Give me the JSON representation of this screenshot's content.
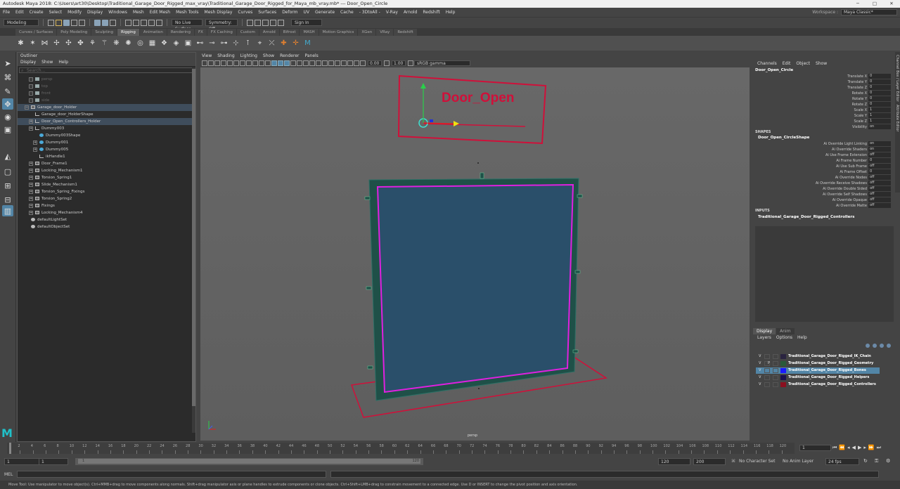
{
  "title": "Autodesk Maya 2018: C:\\Users\\art30\\Desktop\\Traditional_Garage_Door_Rigged_max_vray\\Traditional_Garage_Door_Rigged_for_Maya_mb_vray.mb*   ---   Door_Open_Circle",
  "menus": [
    "File",
    "Edit",
    "Create",
    "Select",
    "Modify",
    "Display",
    "Windows",
    "Mesh",
    "Edit Mesh",
    "Mesh Tools",
    "Mesh Display",
    "Curves",
    "Surfaces",
    "Deform",
    "UV",
    "Generate",
    "Cache",
    "- 3DtoAll -",
    "V-Ray",
    "Arnold",
    "Redshift",
    "Help"
  ],
  "workspace": {
    "label": "Workspace :",
    "value": "Maya Classic*"
  },
  "status": {
    "mode": "Modeling",
    "live_surface": "No Live Surface",
    "symmetry": "Symmetry: Off",
    "sign_in": "Sign In"
  },
  "shelf_tabs": [
    "Curves / Surfaces",
    "Poly Modeling",
    "Sculpting",
    "Rigging",
    "Animation",
    "Rendering",
    "FX",
    "FX Caching",
    "Custom",
    "Arnold",
    "Bifrost",
    "MASH",
    "Motion Graphics",
    "XGen",
    "VRay",
    "Redshift"
  ],
  "active_shelf": "Rigging",
  "outliner": {
    "title": "Outliner",
    "menu": [
      "Display",
      "Show",
      "Help"
    ],
    "search_placeholder": "Search...",
    "items": [
      {
        "label": "persp",
        "dim": true,
        "icon": "camera"
      },
      {
        "label": "top",
        "dim": true,
        "icon": "camera"
      },
      {
        "label": "front",
        "dim": true,
        "icon": "camera"
      },
      {
        "label": "side",
        "dim": true,
        "icon": "camera"
      },
      {
        "label": "Garage_door_Holder",
        "hl": true,
        "icon": "group"
      },
      {
        "label": "Garage_door_HolderShape",
        "icon": "curve"
      },
      {
        "label": "Door_Open_Controllers_Holder",
        "hl": true,
        "icon": "curve"
      },
      {
        "label": "Dummy003",
        "icon": "curve"
      },
      {
        "label": "Dummy003Shape",
        "icon": "joint"
      },
      {
        "label": "Dummy001",
        "icon": "joint"
      },
      {
        "label": "Dummy005",
        "icon": "joint"
      },
      {
        "label": "ikHandle1",
        "icon": "curve"
      },
      {
        "label": "Door_Frame1",
        "icon": "group"
      },
      {
        "label": "Locking_Mechanism1",
        "icon": "group"
      },
      {
        "label": "Torsion_Spring1",
        "icon": "group"
      },
      {
        "label": "Slide_Mechanism1",
        "icon": "group"
      },
      {
        "label": "Torsion_Spring_Fixings",
        "icon": "group"
      },
      {
        "label": "Torsion_Spring2",
        "icon": "group"
      },
      {
        "label": "Fixings",
        "icon": "group"
      },
      {
        "label": "Locking_Mechanism4",
        "icon": "group"
      },
      {
        "label": "defaultLightSet",
        "icon": "set"
      },
      {
        "label": "defaultObjectSet",
        "icon": "set"
      }
    ]
  },
  "viewport": {
    "menu": [
      "View",
      "Shading",
      "Lighting",
      "Show",
      "Renderer",
      "Panels"
    ],
    "exposure": "0.00",
    "gamma": "1.00",
    "color_space": "sRGB gamma",
    "camera_label": "persp",
    "controller_text": "Door_Open"
  },
  "channel_box": {
    "menu": [
      "Channels",
      "Edit",
      "Object",
      "Show"
    ],
    "object": "Door_Open_Circle",
    "channels": [
      {
        "name": "Translate X",
        "value": "0"
      },
      {
        "name": "Translate Y",
        "value": "0"
      },
      {
        "name": "Translate Z",
        "value": "0"
      },
      {
        "name": "Rotate X",
        "value": "0"
      },
      {
        "name": "Rotate Y",
        "value": "0"
      },
      {
        "name": "Rotate Z",
        "value": "0"
      },
      {
        "name": "Scale X",
        "value": "1"
      },
      {
        "name": "Scale Y",
        "value": "1"
      },
      {
        "name": "Scale Z",
        "value": "1"
      },
      {
        "name": "Visibility",
        "value": "on"
      }
    ],
    "shapes_header": "SHAPES",
    "shape_name": "Door_Open_CircleShape",
    "shape_attrs": [
      {
        "name": "Ai Override Light Linking",
        "value": "on"
      },
      {
        "name": "Ai Override Shaders",
        "value": "on"
      },
      {
        "name": "Ai Use Frame Extension",
        "value": "off"
      },
      {
        "name": "Ai Frame Number",
        "value": "0"
      },
      {
        "name": "Ai Use Sub Frame",
        "value": "off"
      },
      {
        "name": "Ai Frame Offset",
        "value": "0"
      },
      {
        "name": "Ai Override Nodes",
        "value": "off"
      },
      {
        "name": "Ai Override Receive Shadows",
        "value": "off"
      },
      {
        "name": "Ai Override Double Sided",
        "value": "off"
      },
      {
        "name": "Ai Override Self Shadows",
        "value": "off"
      },
      {
        "name": "Ai Override Opaque",
        "value": "off"
      },
      {
        "name": "Ai Override Matte",
        "value": "off"
      }
    ],
    "inputs_header": "INPUTS",
    "input_name": "Traditional_Garage_Door_Rigged_Controllers"
  },
  "side_tabs": [
    "Channel Box / Layer Editor",
    "Attribute Editor"
  ],
  "layers": {
    "tabs": [
      "Display",
      "Anim"
    ],
    "menu": [
      "Layers",
      "Options",
      "Help"
    ],
    "rows": [
      {
        "v": "V",
        "p": "",
        "color": "#2a2440",
        "name": "Traditional_Garage_Door_Rigged_IK_Chain",
        "sel": false
      },
      {
        "v": "V",
        "p": "P",
        "color": "#2a5a3a",
        "name": "Traditional_Garage_Door_Rigged_Geometry",
        "sel": false
      },
      {
        "v": "V",
        "p": "",
        "color": "#1a1aff",
        "name": "Traditional_Garage_Door_Rigged_Bones",
        "sel": true
      },
      {
        "v": "V",
        "p": "",
        "color": "#1a1050",
        "name": "Traditional_Garage_Door_Rigged_Helpers",
        "sel": false
      },
      {
        "v": "V",
        "p": "",
        "color": "#8a1020",
        "name": "Traditional_Garage_Door_Rigged_Controllers",
        "sel": false
      }
    ]
  },
  "timeline": {
    "ticks": [
      "2",
      "4",
      "6",
      "8",
      "10",
      "12",
      "14",
      "16",
      "18",
      "20",
      "22",
      "24",
      "26",
      "28",
      "30",
      "32",
      "34",
      "36",
      "38",
      "40",
      "42",
      "44",
      "46",
      "48",
      "50",
      "52",
      "54",
      "56",
      "58",
      "60",
      "62",
      "64",
      "66",
      "68",
      "70",
      "72",
      "74",
      "76",
      "78",
      "80",
      "82",
      "84",
      "86",
      "88",
      "90",
      "92",
      "94",
      "96",
      "98",
      "100",
      "102",
      "104",
      "106",
      "108",
      "110",
      "112",
      "114",
      "116",
      "118",
      "120"
    ],
    "current_frame": "1"
  },
  "range": {
    "start": "1",
    "inner_start": "1",
    "slider_start": "1",
    "slider_end": "120",
    "end": "120",
    "anim_end": "200",
    "character_set": "No Character Set",
    "anim_layer": "No Anim Layer",
    "fps": "24 fps"
  },
  "command": {
    "label": "MEL"
  },
  "help_text": "Move Tool: Use manipulator to move object(s). Ctrl+MMB+drag to move components along normals. Shift+drag manipulator axis or plane handles to extrude components or clone objects. Ctrl+Shift+LMB+drag to constrain movement to a connected edge. Use D or INSERT to change the pivot position and axis orientation.",
  "colors": {
    "accent": "#5285a6",
    "controller": "#d0103a",
    "door_frame": "#1f5048",
    "door_panel": "#2a4f6a",
    "door_wire": "#e020e0"
  }
}
